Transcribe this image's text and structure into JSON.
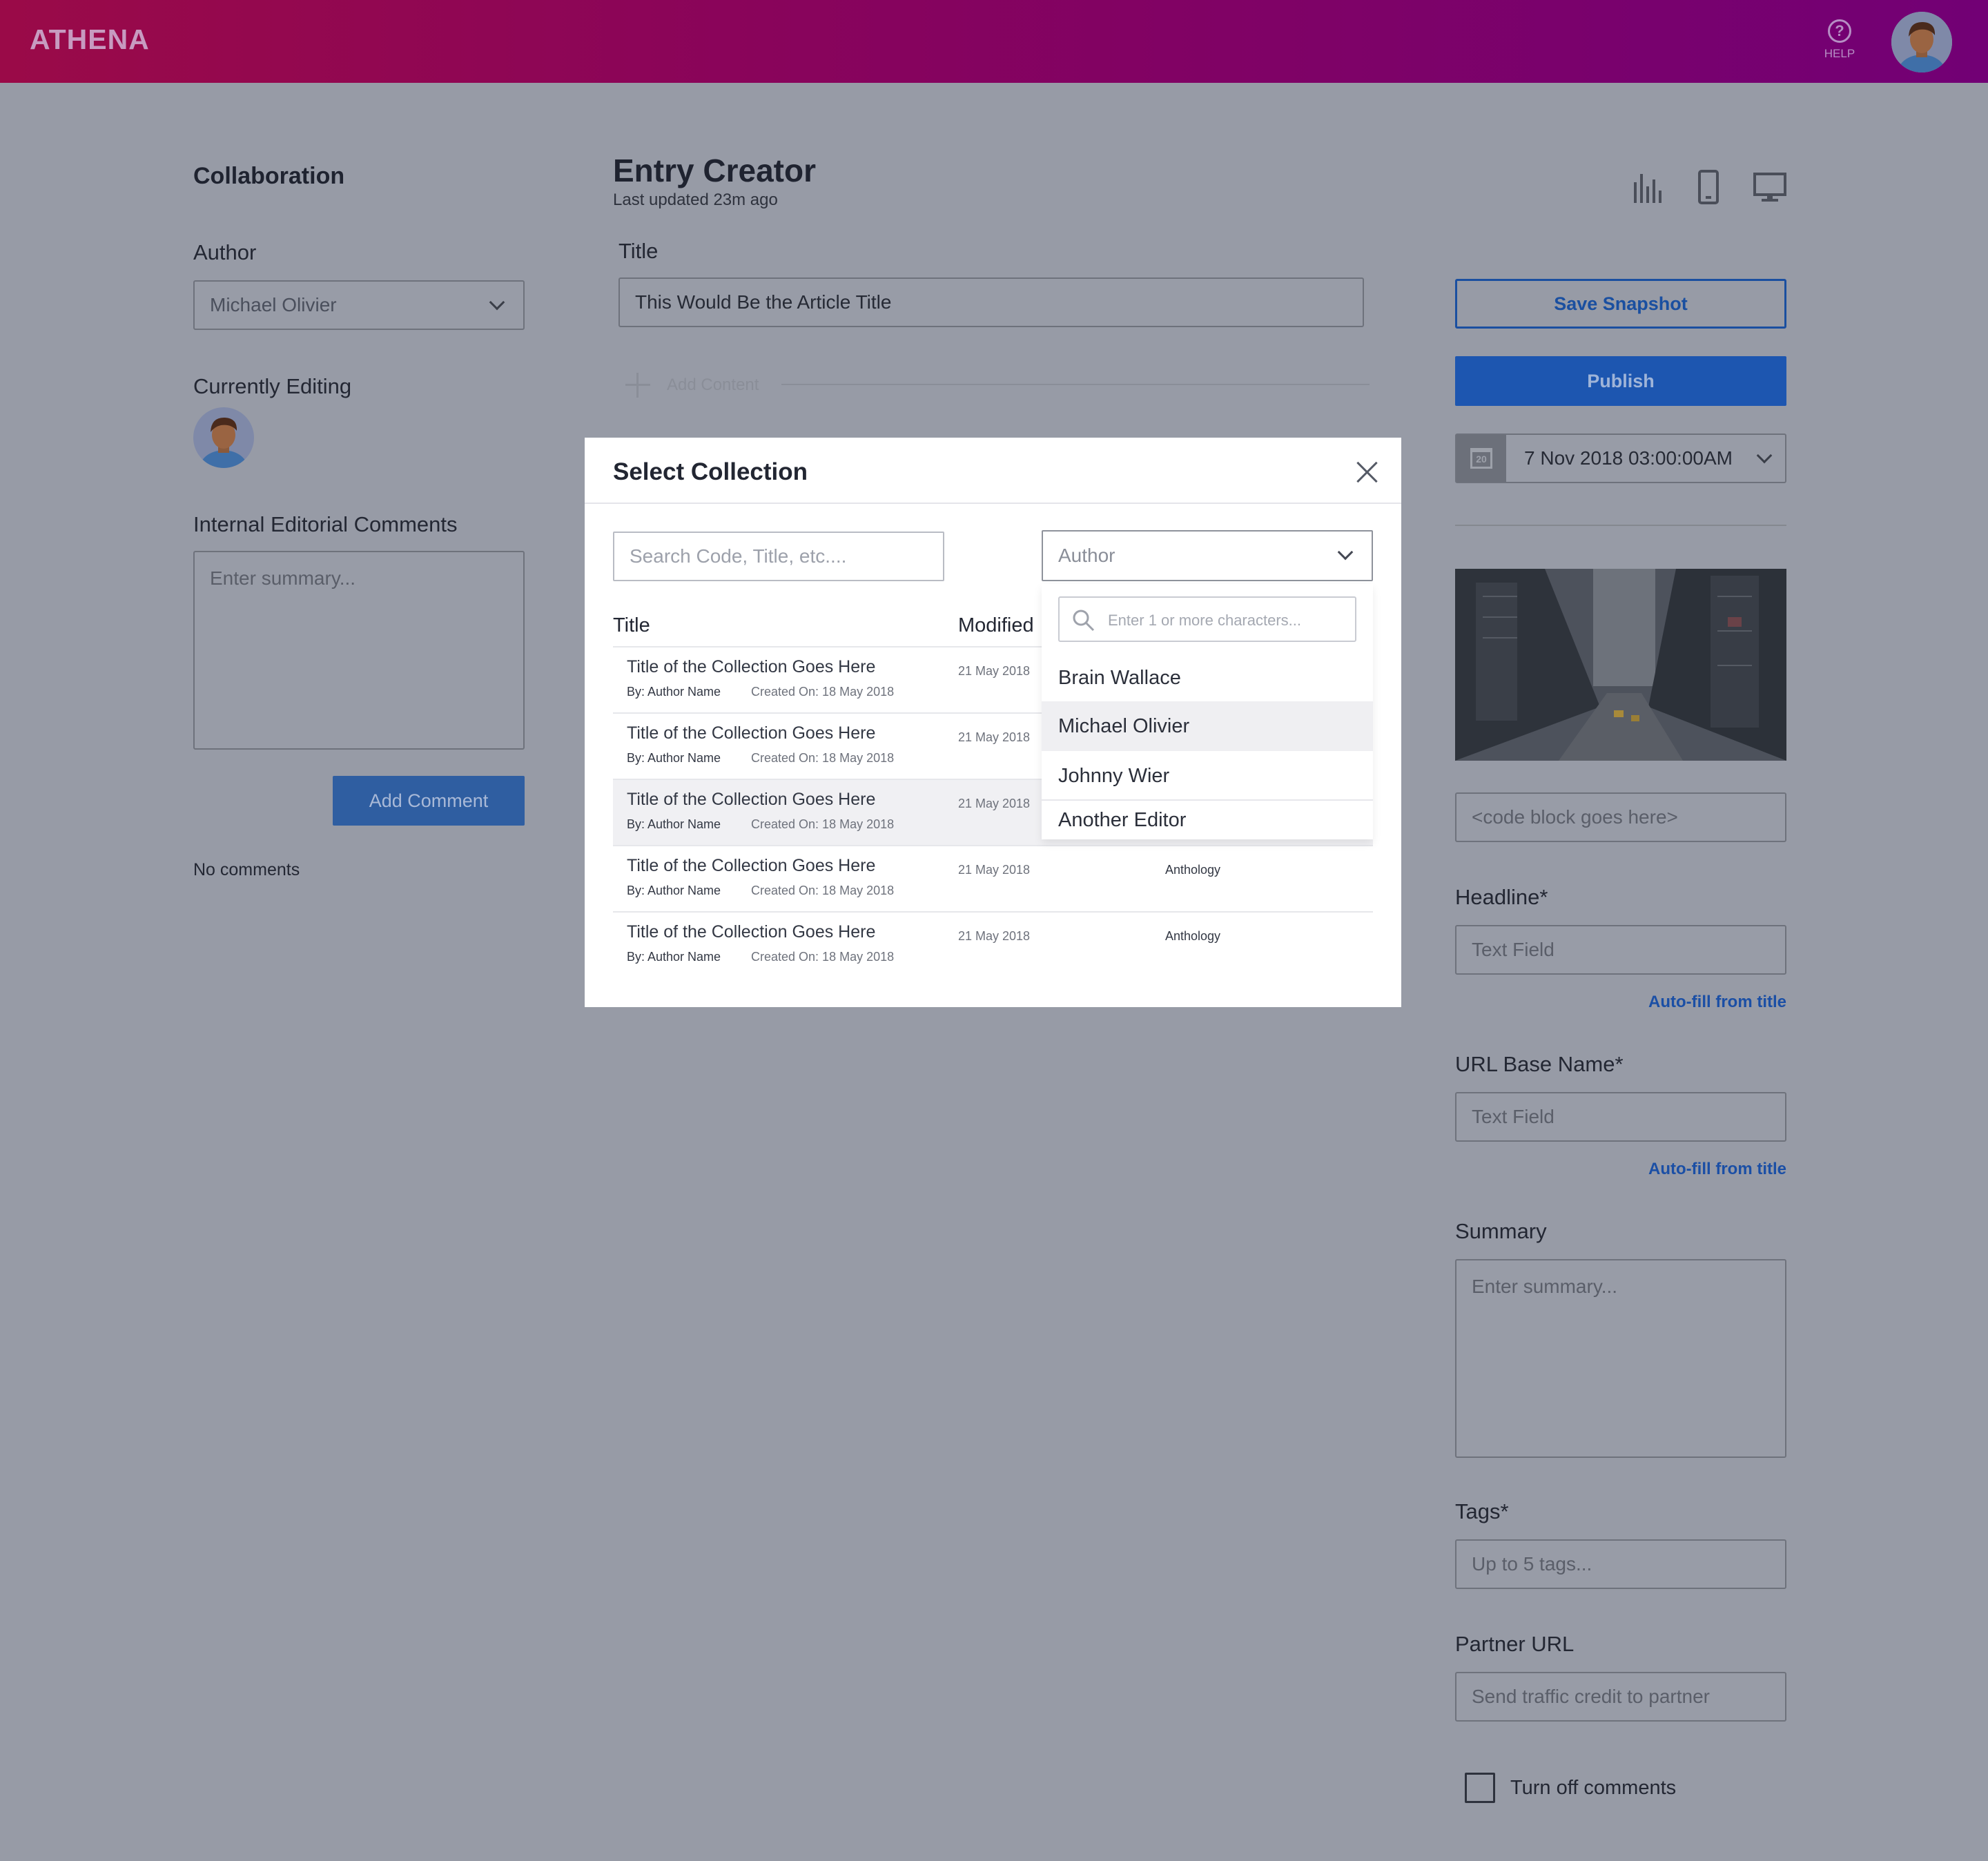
{
  "app": {
    "logo": "ATHENA",
    "help_label": "HELP"
  },
  "collaboration": {
    "title": "Collaboration",
    "author_label": "Author",
    "author_value": "Michael Olivier",
    "currently_editing_label": "Currently Editing",
    "comments_label": "Internal Editorial Comments",
    "comments_placeholder": "Enter summary...",
    "add_comment_button": "Add Comment",
    "no_comments": "No comments"
  },
  "editor": {
    "title": "Entry Creator",
    "last_updated": "Last updated 23m ago",
    "title_label": "Title",
    "title_value": "This Would Be the Article Title",
    "add_content": "Add Content"
  },
  "sidebar": {
    "save_snapshot": "Save Snapshot",
    "publish": "Publish",
    "calendar_day": "20",
    "publish_date": "7 Nov 2018 03:00:00AM",
    "code_placeholder": "<code block goes here>",
    "headline_label": "Headline*",
    "headline_placeholder": "Text Field",
    "autofill_1": "Auto-fill from title",
    "url_label": "URL Base Name*",
    "url_placeholder": "Text Field",
    "autofill_2": "Auto-fill from title",
    "summary_label": "Summary",
    "summary_placeholder": "Enter summary...",
    "tags_label": "Tags*",
    "tags_placeholder": "Up to 5 tags...",
    "partner_label": "Partner URL",
    "partner_placeholder": "Send traffic credit to partner",
    "turn_off_comments": "Turn off comments"
  },
  "modal": {
    "title": "Select Collection",
    "search_placeholder": "Search Code, Title, etc....",
    "author_filter": "Author",
    "col_title": "Title",
    "col_modified": "Modified",
    "rows": [
      {
        "title": "Title of the Collection Goes Here",
        "by": "By: Author Name",
        "created": "Created On: 18 May 2018",
        "modified": "21 May 2018",
        "type": ""
      },
      {
        "title": "Title of the Collection Goes Here",
        "by": "By: Author Name",
        "created": "Created On: 18 May 2018",
        "modified": "21 May 2018",
        "type": ""
      },
      {
        "title": "Title of the Collection Goes Here",
        "by": "By: Author Name",
        "created": "Created On: 18 May 2018",
        "modified": "21 May 2018",
        "type": ""
      },
      {
        "title": "Title of the Collection Goes Here",
        "by": "By: Author Name",
        "created": "Created On: 18 May 2018",
        "modified": "21 May 2018",
        "type": "Anthology"
      },
      {
        "title": "Title of the Collection Goes Here",
        "by": "By: Author Name",
        "created": "Created On: 18 May 2018",
        "modified": "21 May 2018",
        "type": "Anthology"
      }
    ],
    "author_dropdown": {
      "search_placeholder": "Enter 1 or more characters...",
      "options": [
        "Brain Wallace",
        "Michael Olivier",
        "Johnny Wier",
        "Another Editor"
      ],
      "selected": "Michael Olivier"
    }
  }
}
